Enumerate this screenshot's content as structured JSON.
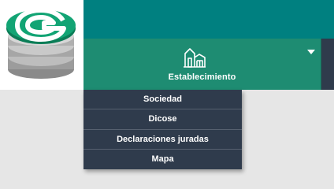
{
  "nav": {
    "menu_label": "Establecimiento",
    "menu_icon": "building-icon",
    "caret_icon": "caret-down-icon"
  },
  "logo": {
    "icon": "coin-stack-g-logo"
  },
  "dropdown": {
    "items": [
      {
        "label": "Sociedad"
      },
      {
        "label": "Dicose"
      },
      {
        "label": "Declaraciones juradas"
      },
      {
        "label": "Mapa"
      }
    ]
  },
  "colors": {
    "topbar": "#008080",
    "nav_active": "#1e8c72",
    "dropdown_bg": "#2f3b4c",
    "page_bg": "#e6e6e6",
    "logo_green": "#0f9a6c"
  }
}
